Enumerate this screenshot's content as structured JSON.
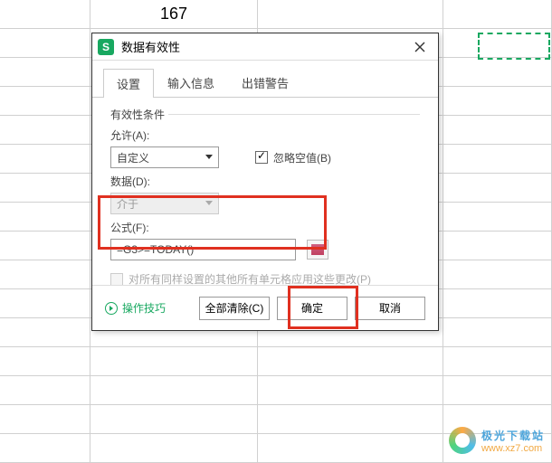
{
  "spreadsheet": {
    "cell_b1": "167"
  },
  "dialog": {
    "title": "数据有效性",
    "tabs": {
      "settings": "设置",
      "input_msg": "输入信息",
      "error_alert": "出错警告"
    },
    "fieldset": "有效性条件",
    "allow_label": "允许(A):",
    "allow_value": "自定义",
    "ignore_blank": "忽略空值(B)",
    "data_label": "数据(D):",
    "data_value": "介于",
    "formula_label": "公式(F):",
    "formula_value": "=G3>=TODAY()",
    "apply_all": "对所有同样设置的其他所有单元格应用这些更改(P)",
    "tips": "操作技巧",
    "clear_all": "全部清除(C)",
    "ok": "确定",
    "cancel": "取消"
  },
  "watermark": {
    "line1": "极光下载站",
    "line2": "www.xz7.com"
  }
}
